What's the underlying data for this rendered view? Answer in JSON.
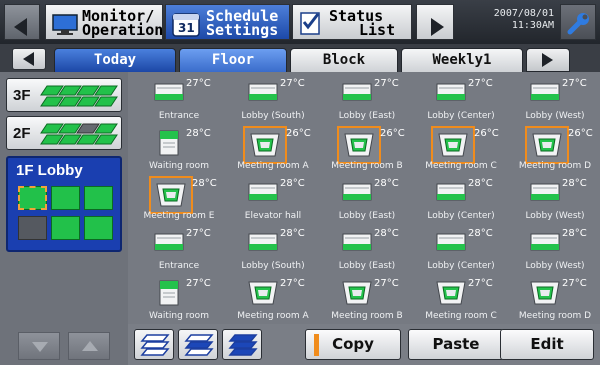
{
  "header": {
    "tabs": [
      {
        "line1": "Monitor/",
        "line2": "Operation",
        "active": false
      },
      {
        "line1": "Schedule",
        "line2": "Settings",
        "active": true
      },
      {
        "line1": "Status",
        "line2": "List",
        "active": false
      }
    ],
    "date": "2007/08/01",
    "time": "11:30AM"
  },
  "subtabs": [
    "Today",
    "Floor",
    "Block",
    "Weekly1"
  ],
  "active_subtab": 0,
  "floors": [
    {
      "label": "3F"
    },
    {
      "label": "2F"
    },
    {
      "label": "1F Lobby"
    }
  ],
  "units": [
    [
      {
        "name": "Entrance",
        "temp": "27°C",
        "type": "wall"
      },
      {
        "name": "Lobby (South)",
        "temp": "27°C",
        "type": "wall"
      },
      {
        "name": "Lobby (East)",
        "temp": "27°C",
        "type": "wall"
      },
      {
        "name": "Lobby (Center)",
        "temp": "27°C",
        "type": "wall"
      },
      {
        "name": "Lobby (West)",
        "temp": "27°C",
        "type": "wall"
      }
    ],
    [
      {
        "name": "Waiting room",
        "temp": "28°C",
        "type": "floor"
      },
      {
        "name": "Meeting room A",
        "temp": "26°C",
        "type": "cassette",
        "selected": true
      },
      {
        "name": "Meeting room B",
        "temp": "26°C",
        "type": "cassette",
        "selected": true
      },
      {
        "name": "Meeting room C",
        "temp": "26°C",
        "type": "cassette",
        "selected": true
      },
      {
        "name": "Meeting room D",
        "temp": "26°C",
        "type": "cassette",
        "selected": true
      }
    ],
    [
      {
        "name": "Meeting room E",
        "temp": "28°C",
        "type": "cassette",
        "selected": true
      },
      {
        "name": "Elevator hall",
        "temp": "28°C",
        "type": "wall"
      },
      {
        "name": "Lobby (East)",
        "temp": "28°C",
        "type": "wall"
      },
      {
        "name": "Lobby (Center)",
        "temp": "28°C",
        "type": "wall"
      },
      {
        "name": "Lobby (West)",
        "temp": "28°C",
        "type": "wall"
      }
    ],
    [
      {
        "name": "Entrance",
        "temp": "27°C",
        "type": "wall"
      },
      {
        "name": "Lobby (South)",
        "temp": "28°C",
        "type": "wall"
      },
      {
        "name": "Lobby (East)",
        "temp": "28°C",
        "type": "wall"
      },
      {
        "name": "Lobby (Center)",
        "temp": "28°C",
        "type": "wall"
      },
      {
        "name": "Lobby (West)",
        "temp": "28°C",
        "type": "wall"
      }
    ],
    [
      {
        "name": "Waiting room",
        "temp": "27°C",
        "type": "floor"
      },
      {
        "name": "Meeting room A",
        "temp": "27°C",
        "type": "cassette"
      },
      {
        "name": "Meeting room B",
        "temp": "27°C",
        "type": "cassette"
      },
      {
        "name": "Meeting room C",
        "temp": "27°C",
        "type": "cassette"
      },
      {
        "name": "Meeting room D",
        "temp": "27°C",
        "type": "cassette"
      }
    ]
  ],
  "bottom": {
    "copy_label": "Copy",
    "paste_label": "Paste",
    "edit_label": "Edit"
  },
  "colors": {
    "accent_blue": "#1d49a8",
    "unit_green": "#22c14a",
    "selection_orange": "#f08c1c"
  },
  "icons": {
    "monitor": "monitor-icon",
    "schedule": "calendar-icon",
    "status": "checklist-icon",
    "maintenance": "wrench-icon"
  }
}
